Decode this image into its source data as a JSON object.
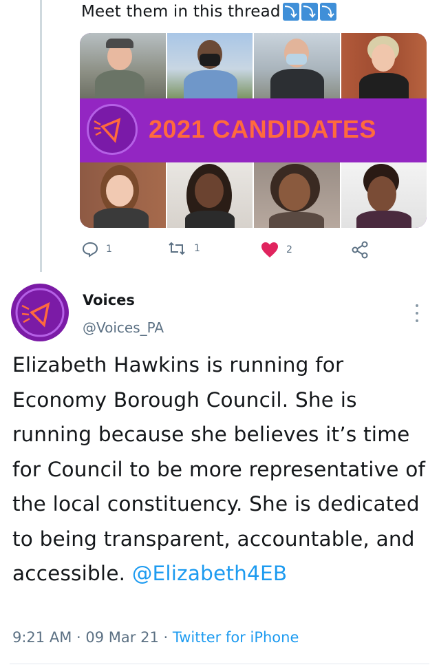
{
  "thread_tweet": {
    "text": "Meet them in this thread",
    "emoji_arrows": [
      "⤵",
      "⤵",
      "⤵"
    ],
    "graphic": {
      "banner_title": "2021 CANDIDATES"
    },
    "actions": {
      "reply_count": "1",
      "retweet_count": "1",
      "like_count": "2"
    }
  },
  "tweet": {
    "display_name": "Voices",
    "handle": "@Voices_PA",
    "body": "Elizabeth Hawkins is running for Economy Borough Council. She is running because she believes it’s time for Council to be more representative of the local constituency. She is dedicated to being transparent, accountable, and accessible.",
    "mention": "@Elizabeth4EB",
    "time": "9:21 AM",
    "date": "09 Mar 21",
    "source": "Twitter for iPhone",
    "separator": "·"
  },
  "colors": {
    "brand_purple": "#9326c2",
    "banner_text": "#ff6a3d",
    "link_blue": "#1d9bf0",
    "like_red": "#e0245e"
  }
}
